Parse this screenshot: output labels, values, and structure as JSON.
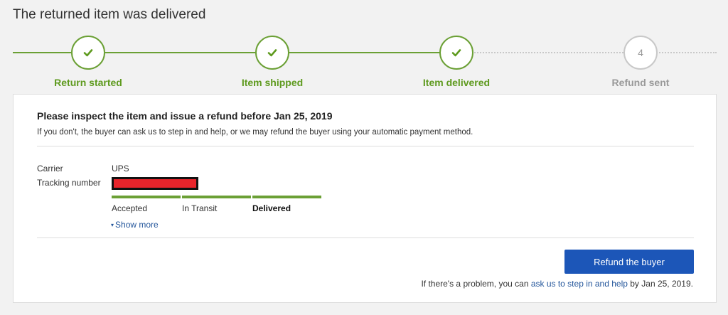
{
  "page": {
    "title": "The returned item was delivered"
  },
  "colors": {
    "success": "#6ba035",
    "pending": "#c8c8c8",
    "primary_button": "#1c56b8",
    "link": "#24569b",
    "redaction": "#e8242b"
  },
  "progress": {
    "steps": [
      {
        "label": "Return started",
        "state": "done",
        "icon": "check-icon"
      },
      {
        "label": "Item shipped",
        "state": "done",
        "icon": "check-icon"
      },
      {
        "label": "Item delivered",
        "state": "done",
        "icon": "check-icon"
      },
      {
        "label": "Refund sent",
        "state": "pending",
        "number": "4"
      }
    ]
  },
  "card": {
    "title": "Please inspect the item and issue a refund before Jan 25, 2019",
    "subtitle": "If you don't, the buyer can ask us to step in and help, or we may refund the buyer using your automatic payment method.",
    "carrier_label": "Carrier",
    "carrier_value": "UPS",
    "tracking_label": "Tracking number",
    "tracking_statuses": [
      {
        "label": "Accepted",
        "complete": true,
        "current": false
      },
      {
        "label": "In Transit",
        "complete": true,
        "current": false
      },
      {
        "label": "Delivered",
        "complete": true,
        "current": true
      }
    ],
    "show_more_label": "Show more",
    "refund_button_label": "Refund the buyer",
    "footer": {
      "prefix": "If there's a problem, you can ",
      "link": "ask us to step in and help",
      "suffix": " by Jan 25, 2019."
    }
  }
}
